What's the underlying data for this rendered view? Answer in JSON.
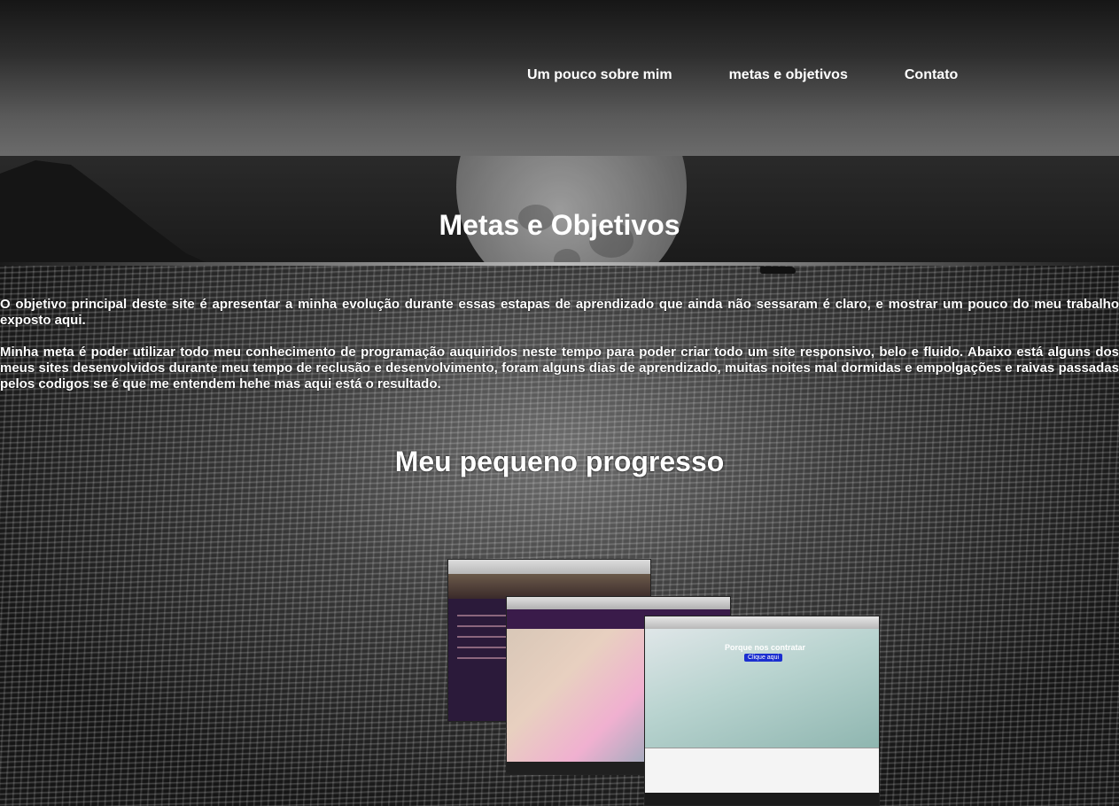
{
  "nav": {
    "items": [
      {
        "label": "Um pouco sobre mim"
      },
      {
        "label": "metas e objetivos"
      },
      {
        "label": "Contato"
      }
    ]
  },
  "main": {
    "title": "Metas e Objetivos",
    "paragraph1": "O objetivo principal deste site é apresentar a minha evolução durante essas estapas de aprendizado que ainda não sessaram é claro, e mostrar um pouco do meu trabalho exposto aqui.",
    "paragraph2": "Minha meta é poder utilizar todo meu conhecimento de programação auquiridos neste tempo para poder criar todo um site responsivo, belo e fluido. Abaixo está alguns dos meus sites desenvolvidos durante meu tempo de reclusão e desenvolvimento, foram alguns dias de aprendizado, muitas noites mal dormidas e empolgações e raivas passadas pelos codigos se é que me entendem hehe mas aqui está o resultado.",
    "progress_title": "Meu pequeno progresso"
  },
  "gallery": {
    "shot3_cta": "Porque nos contratar",
    "shot3_button": "Clique aqui"
  }
}
